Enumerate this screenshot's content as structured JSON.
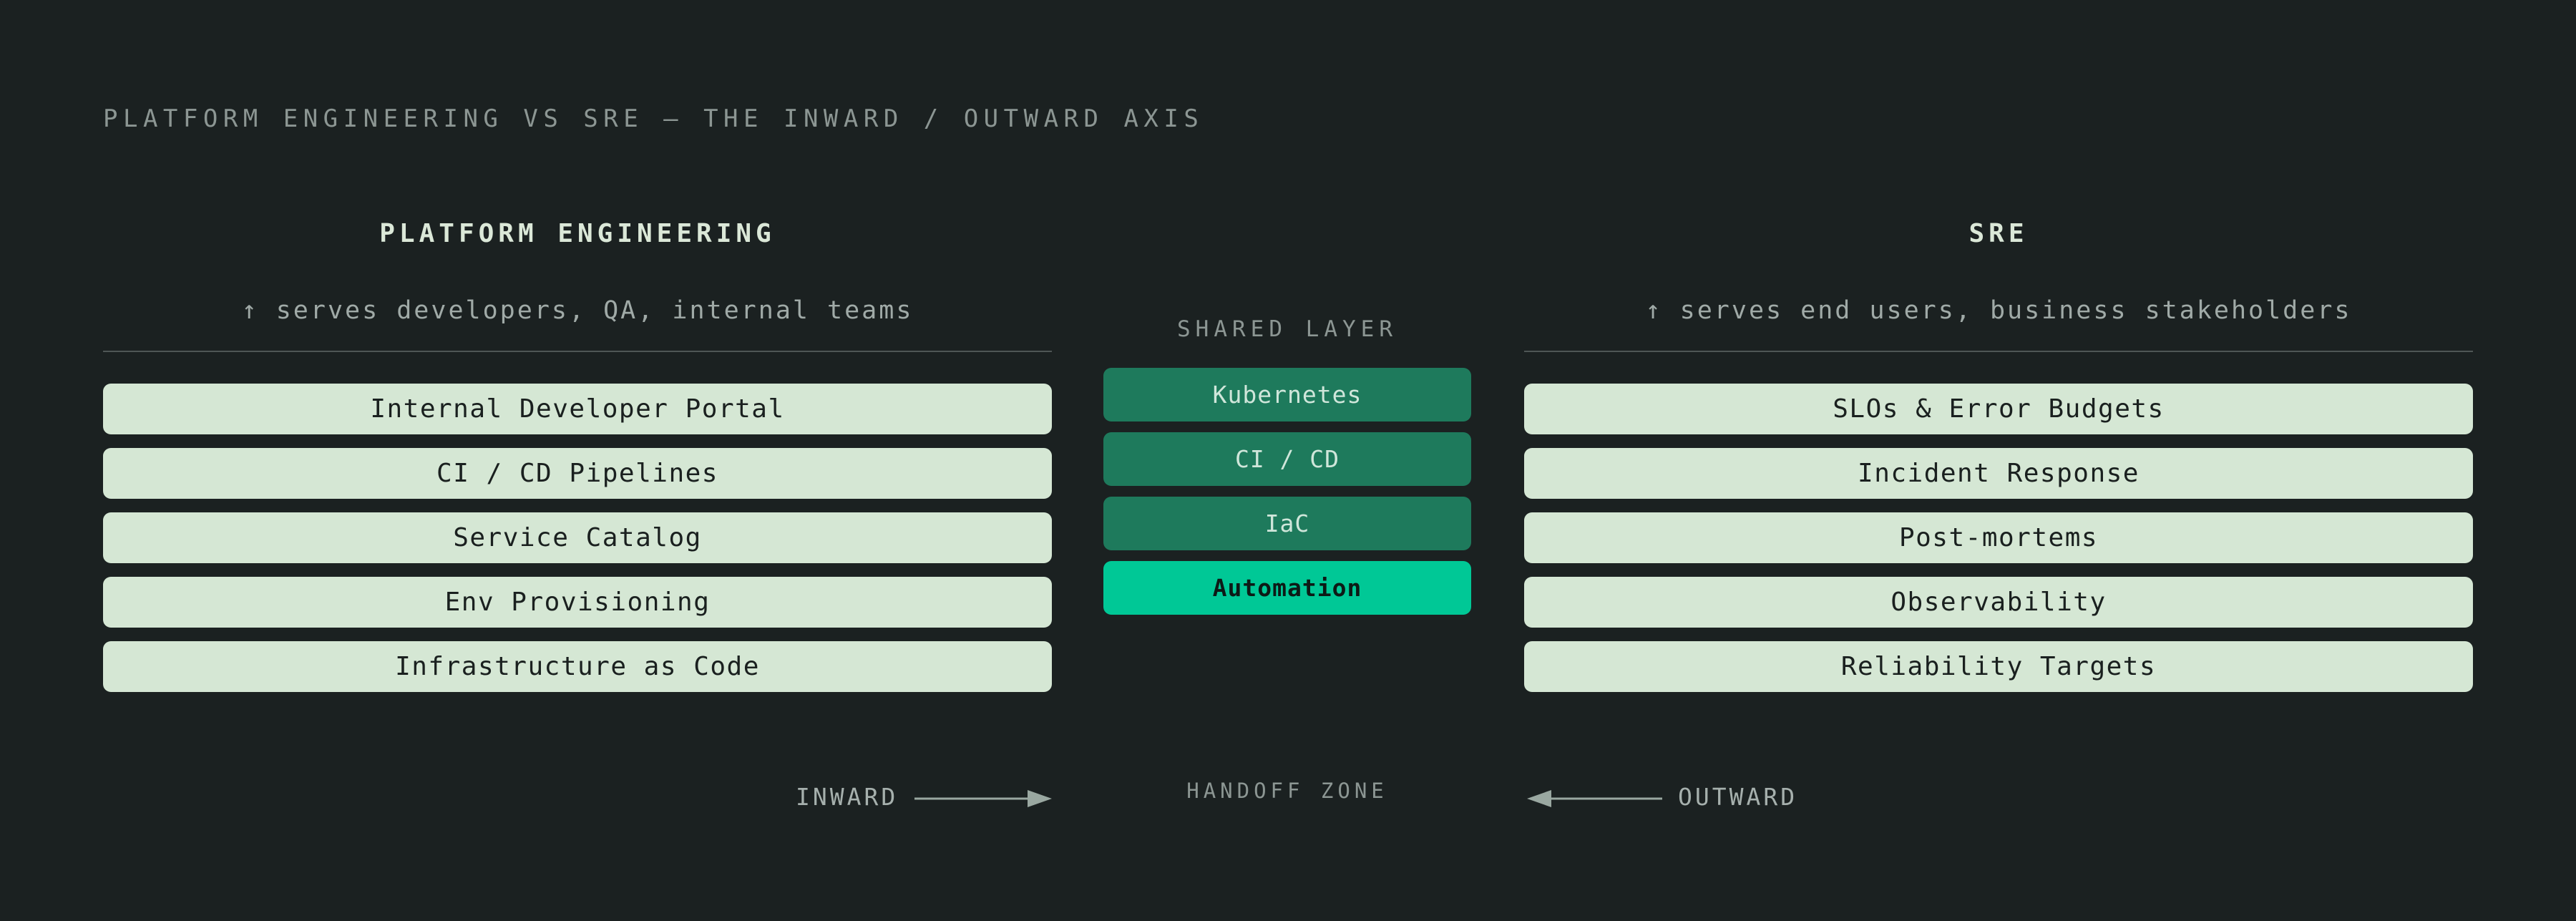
{
  "page_title": "PLATFORM ENGINEERING VS SRE — THE INWARD / OUTWARD AXIS",
  "left": {
    "title": "PLATFORM ENGINEERING",
    "subtitle": "↑ serves developers, QA, internal teams",
    "items": [
      "Internal Developer Portal",
      "CI / CD Pipelines",
      "Service Catalog",
      "Env Provisioning",
      "Infrastructure as Code"
    ]
  },
  "shared": {
    "label": "SHARED LAYER",
    "items": [
      "Kubernetes",
      "CI / CD",
      "IaC",
      "Automation"
    ],
    "highlighted": "Automation"
  },
  "right": {
    "title": "SRE",
    "subtitle": "↑ serves end users, business stakeholders",
    "items": [
      "SLOs & Error Budgets",
      "Incident Response",
      "Post-mortems",
      "Observability",
      "Reliability Targets"
    ]
  },
  "flow": {
    "inward_label": "INWARD",
    "handoff_label": "HANDOFF ZONE",
    "outward_label": "OUTWARD"
  },
  "colors": {
    "background": "#1b2121",
    "card": "#d5e7d4",
    "shared_item": "#1e7a5c",
    "shared_accent": "#00c896",
    "arrow": "#9aa8a1"
  }
}
